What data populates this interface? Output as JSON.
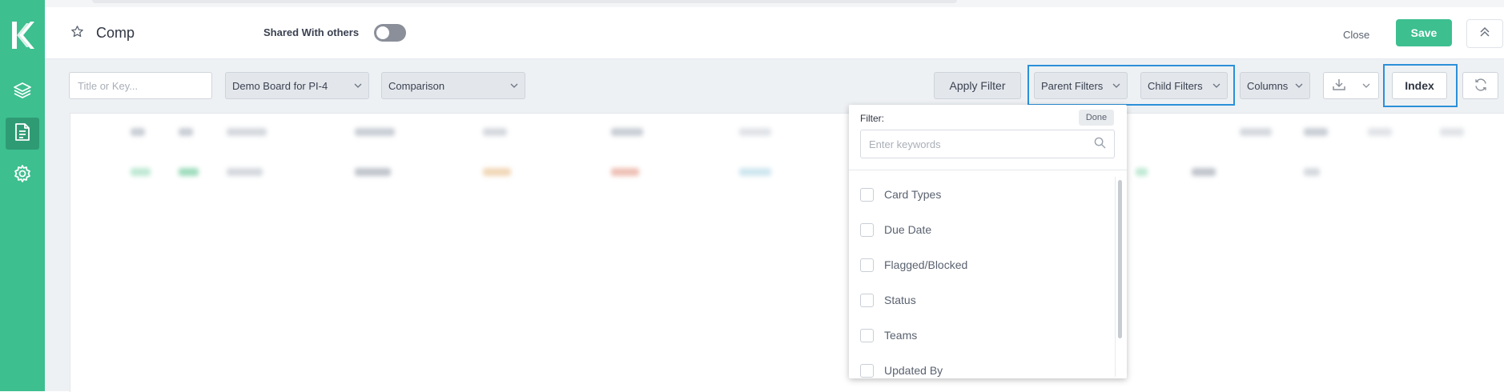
{
  "header": {
    "title": "Comp",
    "shared_label": "Shared With others",
    "close_label": "Close",
    "save_label": "Save"
  },
  "toolbar": {
    "search_placeholder": "Title or Key...",
    "board_select": "Demo Board for PI-4",
    "view_select": "Comparison",
    "apply_filter_label": "Apply Filter",
    "parent_filters_label": "Parent Filters",
    "child_filters_label": "Child Filters",
    "columns_label": "Columns",
    "index_label": "Index"
  },
  "filter_dropdown": {
    "label": "Filter:",
    "done_label": "Done",
    "search_placeholder": "Enter keywords",
    "options": [
      "Card Types",
      "Due Date",
      "Flagged/Blocked",
      "Status",
      "Teams",
      "Updated By"
    ]
  },
  "colors": {
    "brand": "#3dbf90",
    "brand_dark": "#2f9b74",
    "highlight": "#2b90d9"
  },
  "icons": [
    "logo-icon",
    "layers-icon",
    "document-icon",
    "gear-icon",
    "star-icon",
    "chevron-up-icon",
    "download-icon",
    "refresh-icon",
    "search-icon",
    "chevron-down-icon"
  ]
}
